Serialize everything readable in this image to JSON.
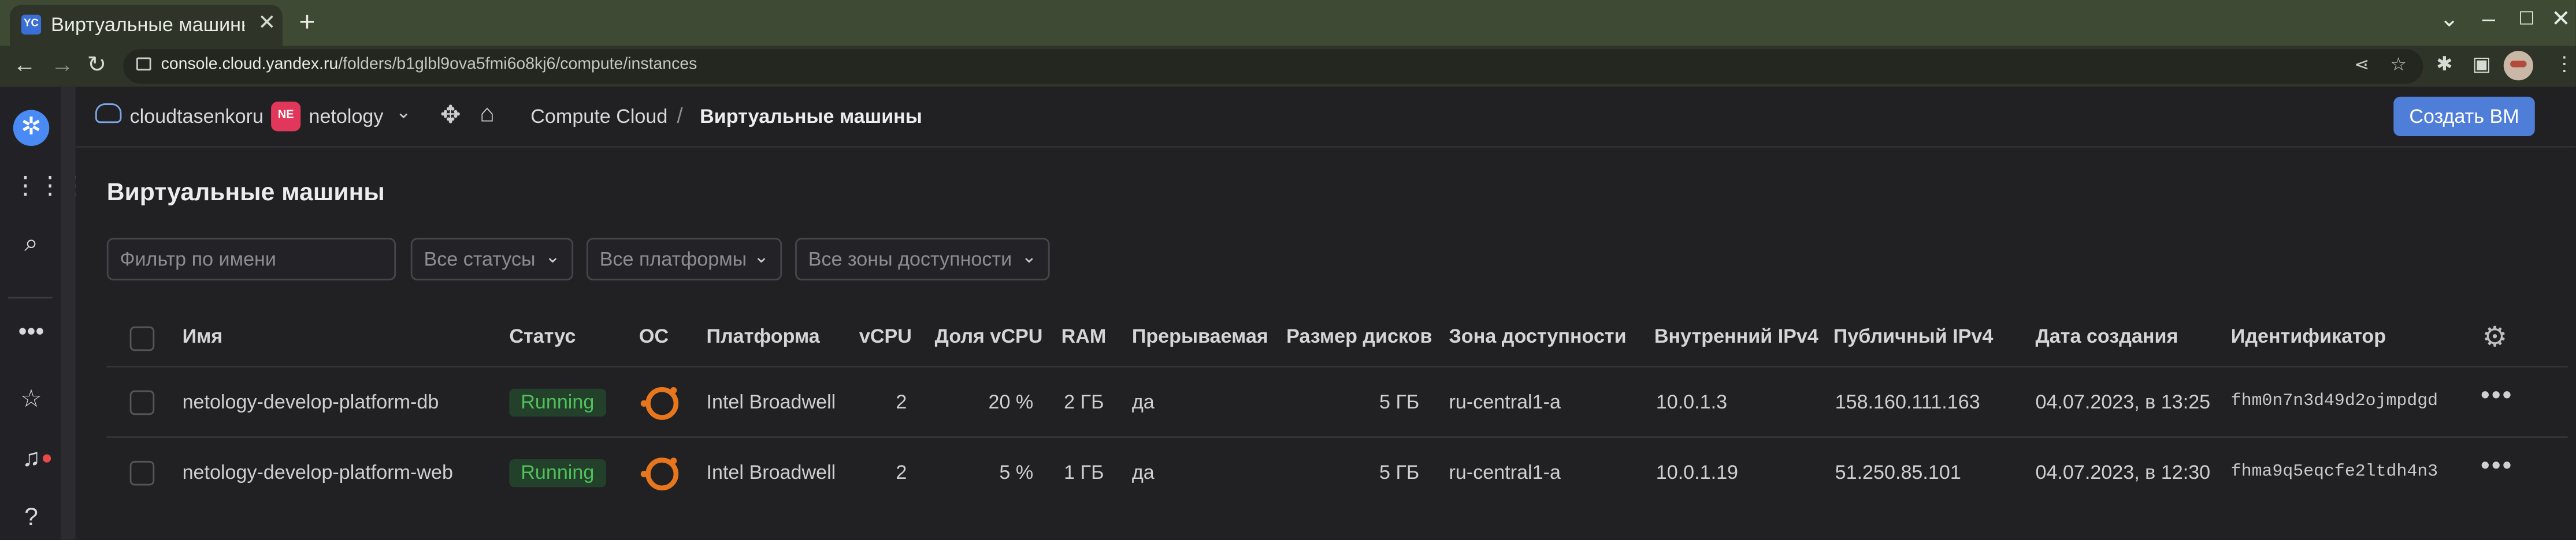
{
  "browser": {
    "tab_title": "Виртуальные машины | Y",
    "tab_favicon": "YC",
    "url_host": "console.cloud.yandex.ru",
    "url_path": "/folders/b1glbl9ova5fmi6o8kj6/compute/instances"
  },
  "header": {
    "cloud_name": "cloudtasenkoru",
    "folder_badge": "NE",
    "folder_name": "netology",
    "breadcrumb_service": "Compute Cloud",
    "breadcrumb_separator": "/",
    "breadcrumb_current": "Виртуальные машины",
    "create_button": "Создать ВМ"
  },
  "page": {
    "title": "Виртуальные машины"
  },
  "filters": {
    "name_placeholder": "Фильтр по имени",
    "status": "Все статусы",
    "platform": "Все платформы",
    "zone": "Все зоны доступности"
  },
  "table": {
    "columns": {
      "name": "Имя",
      "status": "Статус",
      "os": "ОС",
      "platform": "Платформа",
      "vcpu": "vCPU",
      "vcpu_share": "Доля vCPU",
      "ram": "RAM",
      "preemptible": "Прерываемая",
      "disk_size": "Размер дисков",
      "zone": "Зона доступности",
      "internal_ip": "Внутренний IPv4",
      "public_ip": "Публичный IPv4",
      "created": "Дата создания",
      "id": "Идентификатор"
    },
    "rows": [
      {
        "name": "netology-develop-platform-db",
        "status": "Running",
        "os_icon": "ubuntu-icon",
        "platform": "Intel Broadwell",
        "vcpu": "2",
        "vcpu_share": "20 %",
        "ram": "2 ГБ",
        "preemptible": "да",
        "disk_size": "5 ГБ",
        "zone": "ru-central1-a",
        "internal_ip": "10.0.1.3",
        "public_ip": "158.160.111.163",
        "created": "04.07.2023, в 13:25",
        "id": "fhm0n7n3d49d2ojmpdgd"
      },
      {
        "name": "netology-develop-platform-web",
        "status": "Running",
        "os_icon": "ubuntu-icon",
        "platform": "Intel Broadwell",
        "vcpu": "2",
        "vcpu_share": "5 %",
        "ram": "1 ГБ",
        "preemptible": "да",
        "disk_size": "5 ГБ",
        "zone": "ru-central1-a",
        "internal_ip": "10.0.1.19",
        "public_ip": "51.250.85.101",
        "created": "04.07.2023, в 12:30",
        "id": "fhma9q5eqcfe2ltdh4n3"
      }
    ]
  },
  "colors": {
    "accent": "#4f7ed9",
    "running_text": "#4fbf5a",
    "running_bg": "#23402a",
    "folder_badge": "#e0375a",
    "ubuntu": "#e8761c"
  }
}
